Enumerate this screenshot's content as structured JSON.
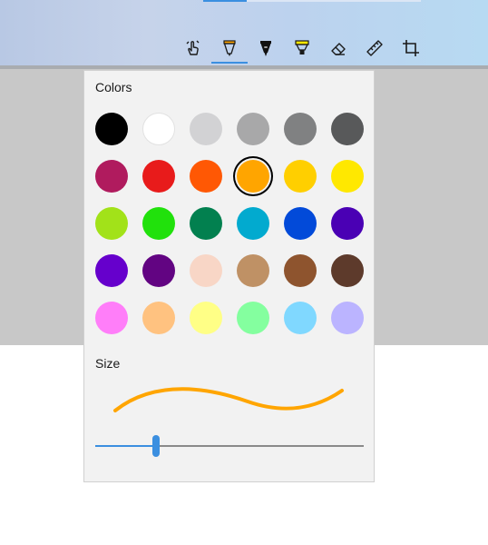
{
  "toolbar": {
    "tools": [
      {
        "name": "touch-writing-icon"
      },
      {
        "name": "ballpoint-pen-icon",
        "active": true
      },
      {
        "name": "pencil-icon"
      },
      {
        "name": "highlighter-icon"
      },
      {
        "name": "eraser-icon"
      },
      {
        "name": "ruler-icon"
      },
      {
        "name": "crop-icon"
      }
    ]
  },
  "panel": {
    "colors_label": "Colors",
    "size_label": "Size",
    "selected_color": "#ffa500",
    "colors": [
      "#000000",
      "#ffffff",
      "#d2d2d4",
      "#a8a8a9",
      "#808182",
      "#58595a",
      "#b01b5e",
      "#e81b1b",
      "#ff5804",
      "#ffa500",
      "#ffcf00",
      "#ffe800",
      "#a2e219",
      "#21e10c",
      "#02804f",
      "#02aacf",
      "#024ad9",
      "#4a00b4",
      "#6600cc",
      "#620482",
      "#f8d6c6",
      "#bf9165",
      "#8e542e",
      "#5d3a2b",
      "#ff7ef9",
      "#ffc280",
      "#ffff86",
      "#84ff9f",
      "#80d8ff",
      "#bbb4ff"
    ],
    "stroke_color": "#ffa500",
    "size_fraction": 0.226
  }
}
